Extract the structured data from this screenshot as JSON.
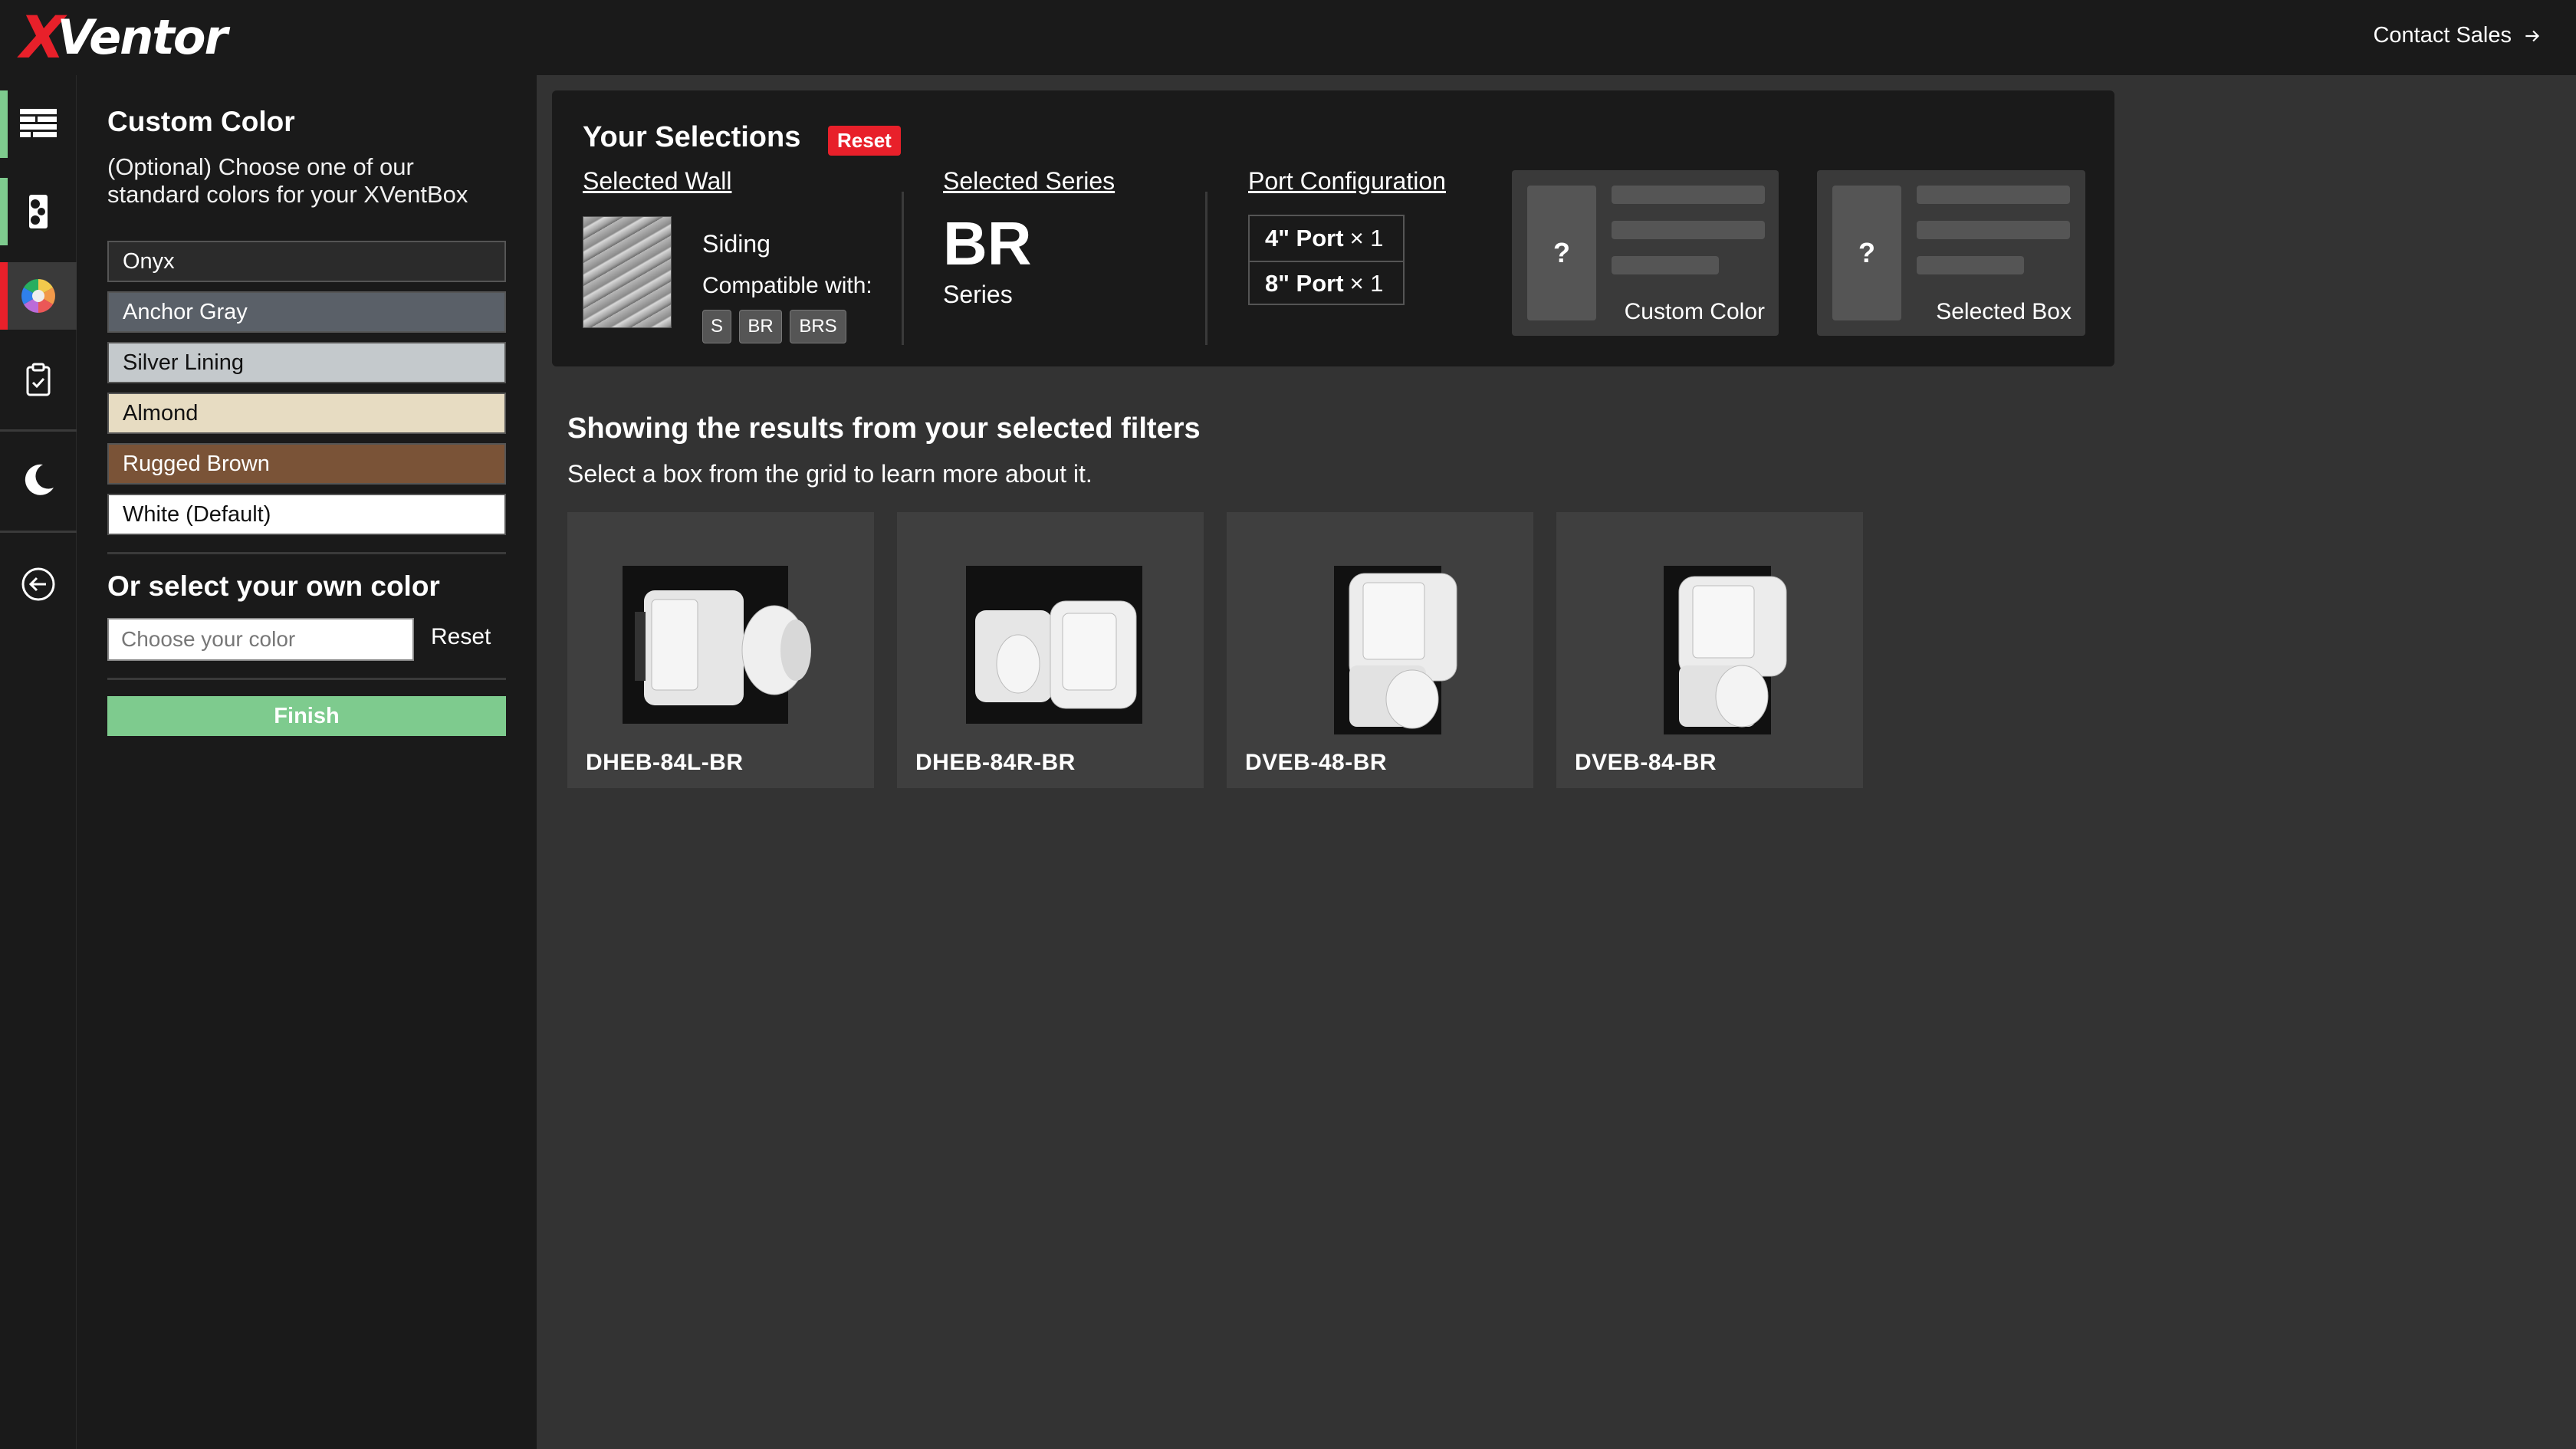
{
  "brand": {
    "logo_x": "X",
    "logo_rest": "Ventor"
  },
  "header": {
    "contact_label": "Contact Sales"
  },
  "rail": {
    "items": [
      {
        "name": "wall-step",
        "accent": "#7ecb8e"
      },
      {
        "name": "series-step",
        "accent": "#7ecb8e"
      },
      {
        "name": "color-step",
        "accent": "#e8202a"
      },
      {
        "name": "summary-step",
        "accent": ""
      },
      {
        "name": "theme-toggle",
        "accent": ""
      },
      {
        "name": "back",
        "accent": ""
      }
    ]
  },
  "panel": {
    "title": "Custom Color",
    "description": "(Optional) Choose one of our standard colors for your XVentBox",
    "swatches": [
      {
        "label": "Onyx",
        "bg": "#2b2b2b",
        "fg": "#ffffff"
      },
      {
        "label": "Anchor Gray",
        "bg": "#5a6068",
        "fg": "#ffffff"
      },
      {
        "label": "Silver Lining",
        "bg": "#c4c9cc",
        "fg": "#111111"
      },
      {
        "label": "Almond",
        "bg": "#e7dcc2",
        "fg": "#111111"
      },
      {
        "label": "Rugged Brown",
        "bg": "#7a5337",
        "fg": "#ffffff"
      },
      {
        "label": "White (Default)",
        "bg": "#ffffff",
        "fg": "#111111"
      }
    ],
    "own_color_title": "Or select your own color",
    "own_color_placeholder": "Choose your color",
    "reset_label": "Reset",
    "finish_label": "Finish"
  },
  "selections": {
    "title": "Your Selections",
    "reset_label": "Reset",
    "wall": {
      "heading": "Selected Wall",
      "name": "Siding",
      "compatible_label": "Compatible with:",
      "tags": [
        "S",
        "BR",
        "BRS"
      ]
    },
    "series": {
      "heading": "Selected Series",
      "code": "BR",
      "label": "Series"
    },
    "ports": {
      "heading": "Port Configuration",
      "rows": [
        {
          "size": "4\" Port",
          "qty": "× 1"
        },
        {
          "size": "8\" Port",
          "qty": "× 1"
        }
      ]
    },
    "placeholders": [
      {
        "mark": "?",
        "label": "Custom Color"
      },
      {
        "mark": "?",
        "label": "Selected Box"
      }
    ]
  },
  "results": {
    "title": "Showing the results from your selected filters",
    "subtitle": "Select a box from the grid to learn more about it.",
    "products": [
      {
        "code": "DHEB-84L-BR"
      },
      {
        "code": "DHEB-84R-BR"
      },
      {
        "code": "DVEB-48-BR"
      },
      {
        "code": "DVEB-84-BR"
      }
    ]
  }
}
